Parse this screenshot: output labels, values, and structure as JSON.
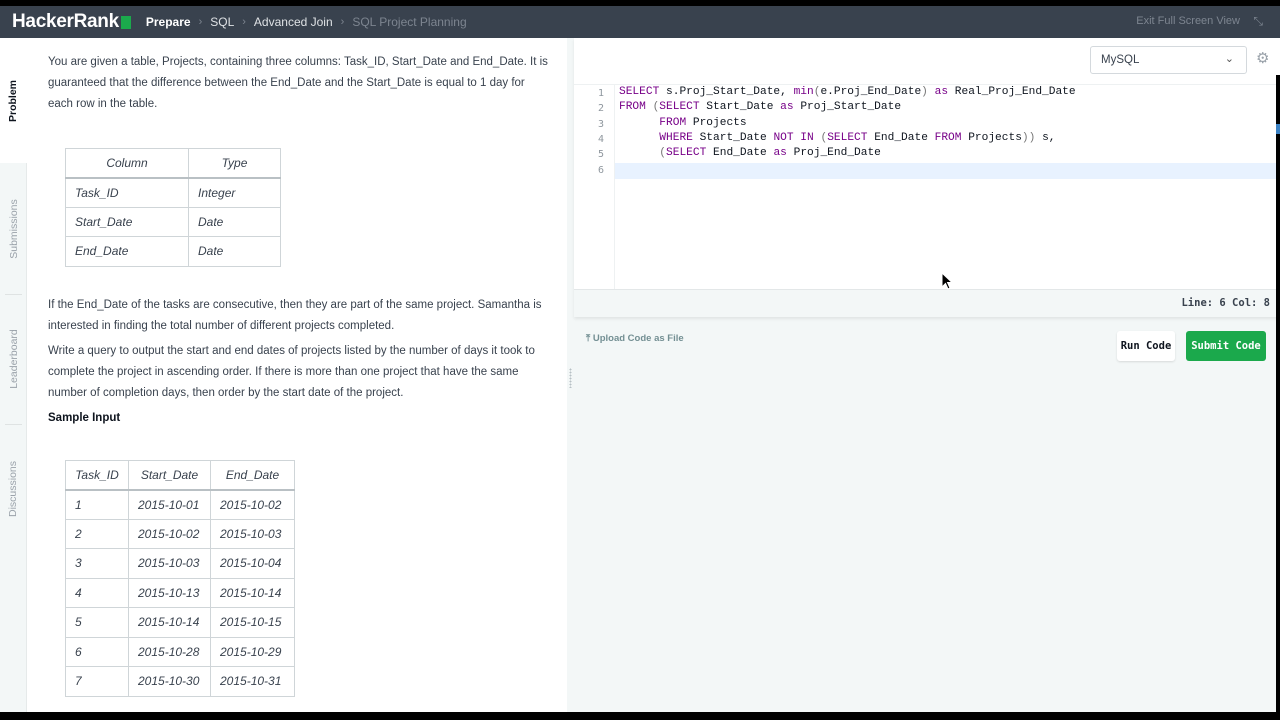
{
  "header": {
    "logo": "HackerRank",
    "breadcrumbs": [
      "Prepare",
      "SQL",
      "Advanced Join",
      "SQL Project Planning"
    ],
    "exit_label": "Exit Full Screen View"
  },
  "side_tabs": [
    "Problem",
    "Submissions",
    "Leaderboard",
    "Discussions"
  ],
  "problem": {
    "intro": "You are given a table, Projects, containing three columns: Task_ID, Start_Date and End_Date. It is guaranteed that the difference between the End_Date and the Start_Date is equal to 1 day for each row in the table.",
    "schema": {
      "headers": [
        "Column",
        "Type"
      ],
      "rows": [
        [
          "Task_ID",
          "Integer"
        ],
        [
          "Start_Date",
          "Date"
        ],
        [
          "End_Date",
          "Date"
        ]
      ]
    },
    "para2": "If the End_Date of the tasks are consecutive, then they are part of the same project. Samantha is interested in finding the total number of different projects completed.",
    "para3": "Write a query to output the start and end dates of projects listed by the number of days it took to complete the project in ascending order. If there is more than one project that have the same number of completion days, then order by the start date of the project.",
    "sample_heading": "Sample Input",
    "sample": {
      "headers": [
        "Task_ID",
        "Start_Date",
        "End_Date"
      ],
      "rows": [
        [
          "1",
          "2015-10-01",
          "2015-10-02"
        ],
        [
          "2",
          "2015-10-02",
          "2015-10-03"
        ],
        [
          "3",
          "2015-10-03",
          "2015-10-04"
        ],
        [
          "4",
          "2015-10-13",
          "2015-10-14"
        ],
        [
          "5",
          "2015-10-14",
          "2015-10-15"
        ],
        [
          "6",
          "2015-10-28",
          "2015-10-29"
        ],
        [
          "7",
          "2015-10-30",
          "2015-10-31"
        ]
      ]
    }
  },
  "editor": {
    "language": "MySQL",
    "line_numbers": [
      "1",
      "2",
      "3",
      "4",
      "5",
      "6"
    ],
    "status": "Line: 6 Col: 8"
  },
  "actions": {
    "upload": "Upload Code as File",
    "run": "Run Code",
    "submit": "Submit Code"
  }
}
